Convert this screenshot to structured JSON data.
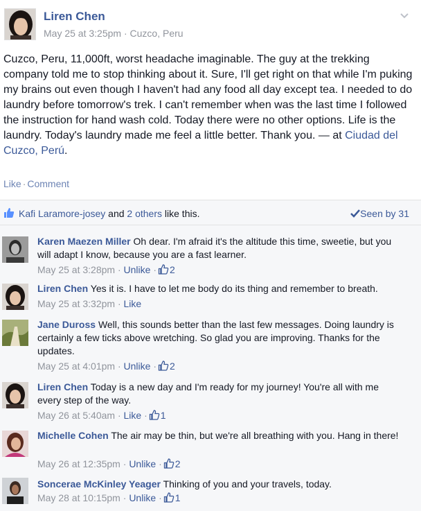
{
  "post": {
    "author": "Liren Chen",
    "date": "May 25 at 3:25pm",
    "location": "Cuzco, Peru",
    "text_prefix": "Cuzco, Peru, 11,000ft, worst headache imaginable. The guy at the trekking company told me to stop thinking about it. Sure, I'll get right on that while I'm puking my brains out even though I haven't had any food all day except tea. I needed to do laundry before tomorrow's trek. I can't remember when was the last time I followed the instruction for hand wash cold. Today there were no other options. Life is the laundry. Today's laundry made me feel a little better. Thank you. — at ",
    "place_link": "Ciudad del Cuzco, Perú",
    "place_suffix": ".",
    "like_label": "Like",
    "comment_label": "Comment"
  },
  "feedback": {
    "liker": "Kafi Laramore-josey",
    "and": "and",
    "others": "2 others",
    "like_this": "like this.",
    "seen_by": "Seen by 31"
  },
  "comments": [
    {
      "author": "Karen Maezen Miller",
      "text": "Oh dear. I'm afraid it's the altitude this time, sweetie, but you will adapt I know, because you are a fast learner.",
      "time": "May 25 at 3:28pm",
      "action": "Unlike",
      "likes": "2"
    },
    {
      "author": "Liren Chen",
      "text": "Yes it is. I have to let me body do its thing and remember to breath.",
      "time": "May 25 at 3:32pm",
      "action": "Like",
      "likes": ""
    },
    {
      "author": "Jane Duross",
      "text": "Well, this sounds better than the last few messages. Doing laundry is certainly a few ticks above wretching. So glad you are improving. Thanks for the updates.",
      "time": "May 25 at 4:01pm",
      "action": "Unlike",
      "likes": "2"
    },
    {
      "author": "Liren Chen",
      "text": "Today is a new day and I'm ready for my journey! You're all with me every step of the way.",
      "time": "May 26 at 5:40am",
      "action": "Like",
      "likes": "1"
    },
    {
      "author": "Michelle Cohen",
      "text": "The air may be thin, but we're all breathing with you. Hang in there!",
      "time": "May 26 at 12:35pm",
      "action": "Unlike",
      "likes": "2"
    },
    {
      "author": "Soncerae McKinley Yeager",
      "text": "Thinking of you and your travels, today.",
      "time": "May 28 at 10:15pm",
      "action": "Unlike",
      "likes": "1"
    }
  ],
  "sep": "·",
  "colors": {
    "link": "#3b5998",
    "meta": "#90949c",
    "panel": "#f6f7f9"
  }
}
